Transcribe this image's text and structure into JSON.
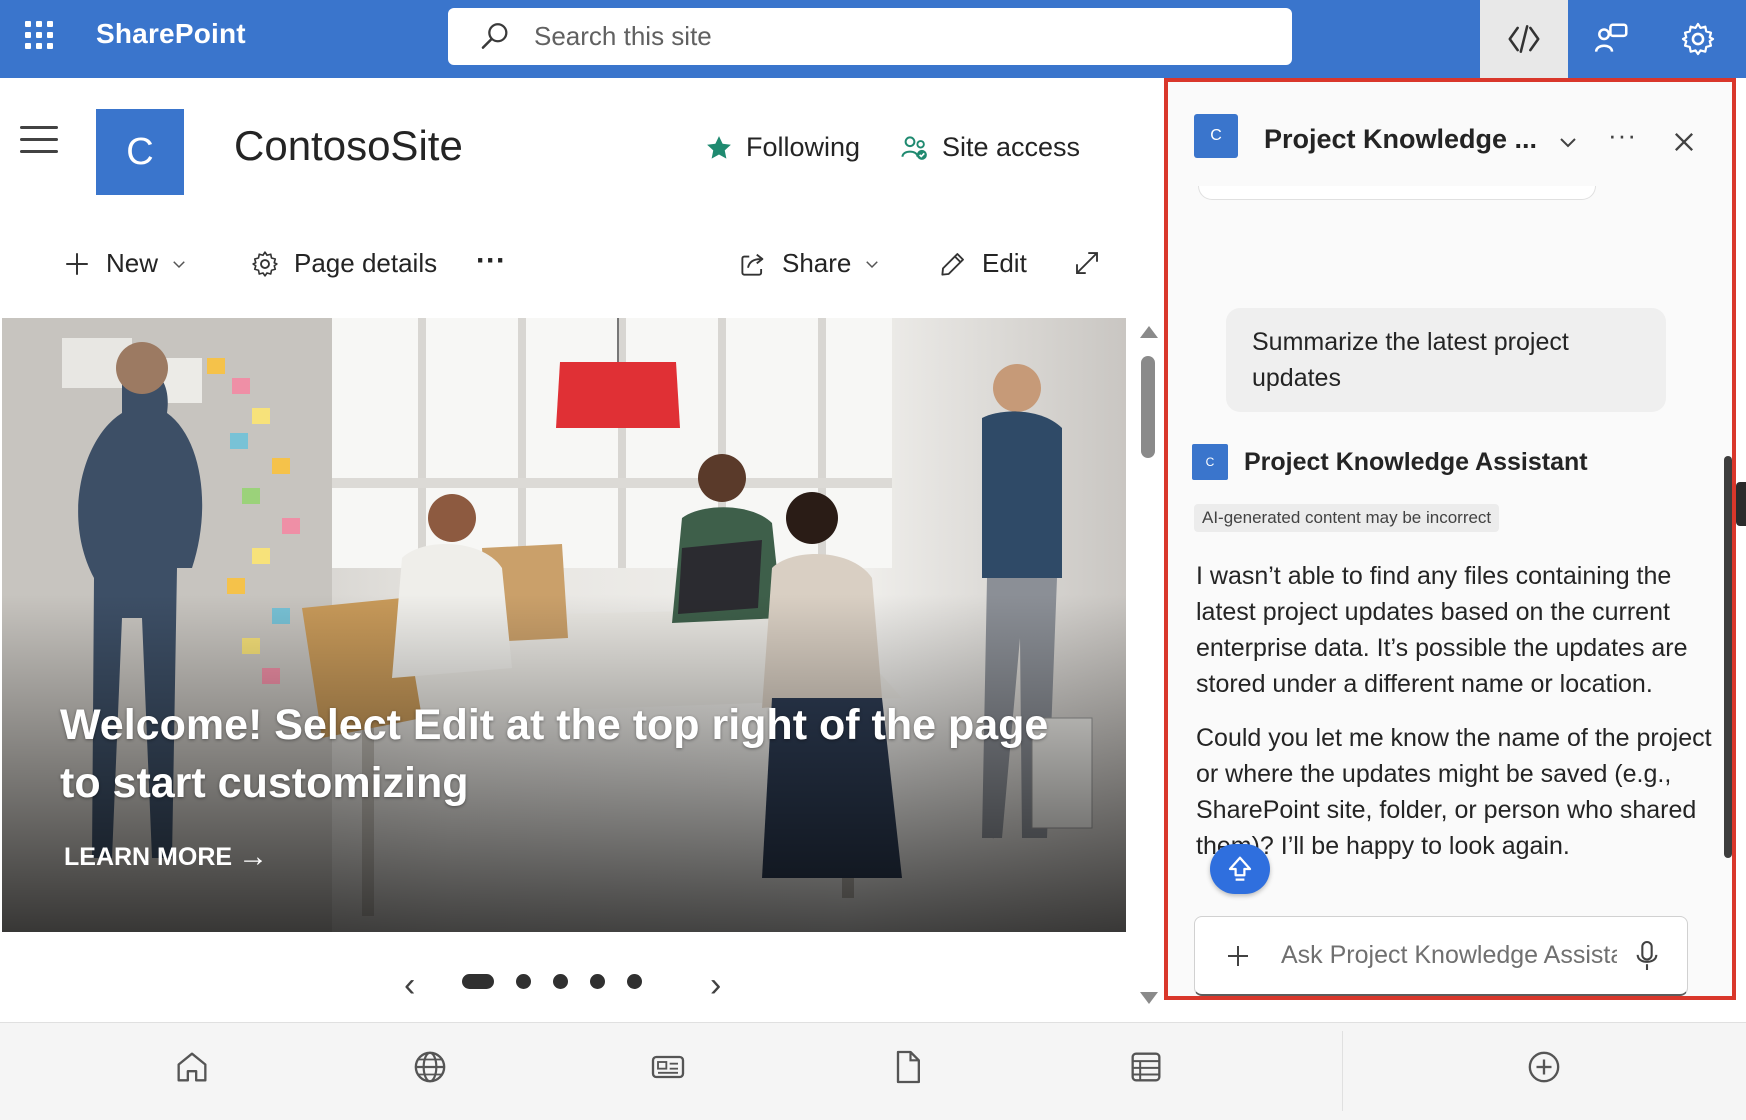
{
  "suite_bar": {
    "brand": "SharePoint",
    "search_placeholder": "Search this site"
  },
  "site": {
    "logo_letter": "C",
    "title": "ContosoSite",
    "following_label": "Following",
    "site_access_label": "Site access"
  },
  "command_bar": {
    "new_label": "New",
    "page_details_label": "Page details",
    "more_label": "···",
    "share_label": "Share",
    "edit_label": "Edit"
  },
  "hero": {
    "title": "Welcome! Select Edit at the top right of the page to start customizing",
    "learn_more": "LEARN MORE",
    "slide_count": 5,
    "active_slide": 1
  },
  "copilot_panel": {
    "avatar_letter": "C",
    "title": "Project Knowledge ...",
    "more_label": "···",
    "user_message": "Summarize the latest project updates",
    "assistant_name": "Project Knowledge Assistant",
    "ai_disclaimer": "AI-generated content may be incorrect",
    "response_p1": "I wasn’t able to find any files containing the latest project updates based on the current enterprise data. It’s possible the updates are stored under a different name or location.",
    "response_p2": "Could you let me know the name of the project or where the updates might be saved (e.g., SharePoint site, folder, or person who shared them)? I’ll be happy to look again.",
    "composer_placeholder": "Ask Project Knowledge Assista"
  },
  "colors": {
    "suite_blue": "#3a75cc",
    "panel_highlight": "#d9372b",
    "jump_button": "#2f6fde"
  },
  "icons": {
    "bottom_bar": [
      "home-icon",
      "globe-icon",
      "news-icon",
      "document-icon",
      "list-icon",
      "add-circle-icon"
    ]
  }
}
